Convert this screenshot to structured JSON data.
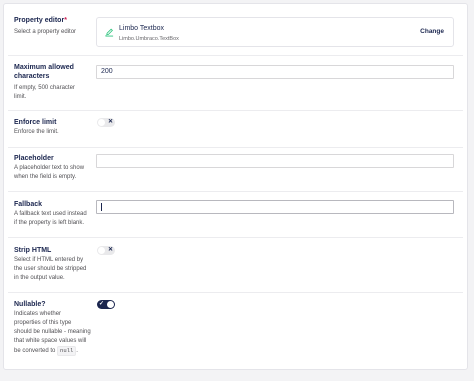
{
  "fields": {
    "property_editor": {
      "label": "Property editor",
      "required_mark": "*",
      "description": "Select a property editor",
      "editor_name": "Limbo Textbox",
      "editor_alias": "Limbo.Umbraco.TextBox",
      "change_label": "Change",
      "icon": "pencil-icon",
      "icon_color": "#2bc37c"
    },
    "max_chars": {
      "label_line1": "Maximum allowed",
      "label_line2": "characters",
      "desc_line1": "If empty, 500 character",
      "desc_line2": "limit.",
      "value": "200"
    },
    "enforce_limit": {
      "label": "Enforce limit",
      "description": "Enforce the limit.",
      "toggle_icon": "✕",
      "checked": false
    },
    "placeholder": {
      "label": "Placeholder",
      "desc_line1": "A placeholder text to show",
      "desc_line2": "when the field is empty.",
      "value": ""
    },
    "fallback": {
      "label": "Fallback",
      "desc_line1": "A fallback text used instead",
      "desc_line2": "if the property is left blank.",
      "value": ""
    },
    "strip_html": {
      "label": "Strip HTML",
      "desc_line1": "Select if HTML entered by",
      "desc_line2": "the user should be stripped",
      "desc_line3": "in the output value.",
      "toggle_icon": "✕",
      "checked": false
    },
    "nullable": {
      "label": "Nullable?",
      "desc_line1": "Indicates whether",
      "desc_line2": "properties of this type",
      "desc_line3": "should be nullable - meaning",
      "desc_line4": "that white space values will",
      "desc_line5_pre": "be converted to",
      "desc_code": "null",
      "desc_line5_post": ".",
      "toggle_icon": "✓",
      "checked": true
    }
  },
  "colors": {
    "accent": "#1b264f",
    "required": "#d42054",
    "toggle_off": "#e9e9eb"
  }
}
